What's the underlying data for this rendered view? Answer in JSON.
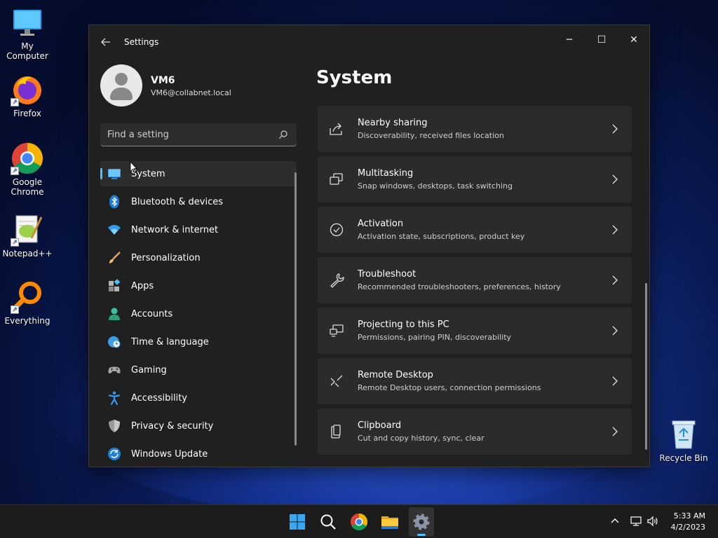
{
  "desktop": {
    "icons": [
      {
        "label": "My Computer"
      },
      {
        "label": "Firefox"
      },
      {
        "label": "Google\nChrome"
      },
      {
        "label": "Notepad++"
      },
      {
        "label": "Everything"
      },
      {
        "label": "Recycle Bin"
      }
    ]
  },
  "window": {
    "title": "Settings",
    "controls": {
      "minimize": "─",
      "maximize": "☐",
      "close": "✕"
    }
  },
  "user": {
    "name": "VM6",
    "email": "VM6@collabnet.local"
  },
  "search": {
    "placeholder": "Find a setting"
  },
  "nav": [
    {
      "label": "System",
      "icon": "monitor-icon",
      "active": true
    },
    {
      "label": "Bluetooth & devices",
      "icon": "bluetooth-icon"
    },
    {
      "label": "Network & internet",
      "icon": "wifi-icon"
    },
    {
      "label": "Personalization",
      "icon": "brush-icon"
    },
    {
      "label": "Apps",
      "icon": "apps-icon"
    },
    {
      "label": "Accounts",
      "icon": "person-icon"
    },
    {
      "label": "Time & language",
      "icon": "globe-clock-icon"
    },
    {
      "label": "Gaming",
      "icon": "gamepad-icon"
    },
    {
      "label": "Accessibility",
      "icon": "accessibility-icon"
    },
    {
      "label": "Privacy & security",
      "icon": "shield-icon"
    },
    {
      "label": "Windows Update",
      "icon": "update-icon"
    }
  ],
  "content": {
    "title": "System",
    "cards": [
      {
        "title": "Nearby sharing",
        "subtitle": "Discoverability, received files location",
        "icon": "share-icon"
      },
      {
        "title": "Multitasking",
        "subtitle": "Snap windows, desktops, task switching",
        "icon": "multitask-icon"
      },
      {
        "title": "Activation",
        "subtitle": "Activation state, subscriptions, product key",
        "icon": "check-circle-icon"
      },
      {
        "title": "Troubleshoot",
        "subtitle": "Recommended troubleshooters, preferences, history",
        "icon": "wrench-icon"
      },
      {
        "title": "Projecting to this PC",
        "subtitle": "Permissions, pairing PIN, discoverability",
        "icon": "projector-icon"
      },
      {
        "title": "Remote Desktop",
        "subtitle": "Remote Desktop users, connection permissions",
        "icon": "remote-desktop-icon"
      },
      {
        "title": "Clipboard",
        "subtitle": "Cut and copy history, sync, clear",
        "icon": "clipboard-icon"
      }
    ]
  },
  "taskbar": {
    "time": "5:33 AM",
    "date": "4/2/2023"
  },
  "colors": {
    "accent": "#4cc2ff",
    "window_bg": "#202020",
    "card_bg": "#2b2b2b"
  }
}
